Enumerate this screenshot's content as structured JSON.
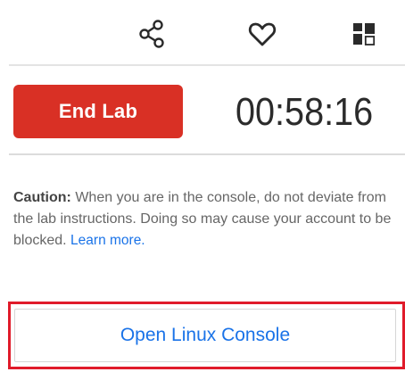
{
  "toolbar": {
    "icons": [
      "share-icon",
      "heart-icon",
      "dashboard-icon"
    ]
  },
  "lab": {
    "end_button_label": "End Lab",
    "timer": "00:58:16"
  },
  "caution": {
    "label": "Caution:",
    "text": " When you are in the console, do not deviate from the lab instructions. Doing so may cause your account to be blocked. ",
    "link_label": "Learn more."
  },
  "console": {
    "button_label": "Open Linux Console"
  },
  "colors": {
    "end_button_bg": "#d93025",
    "link": "#1a73e8",
    "highlight_outline": "#e01b2a"
  }
}
